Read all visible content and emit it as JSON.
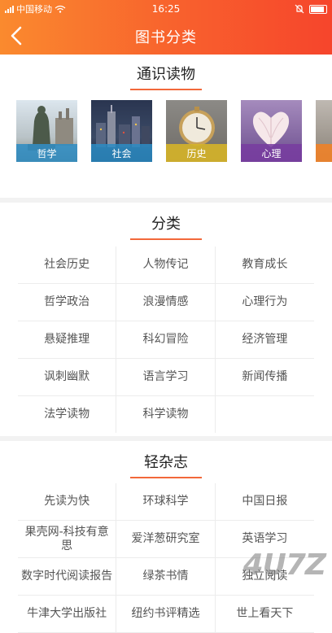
{
  "status_bar": {
    "carrier": "中国移动",
    "time": "16:25"
  },
  "nav": {
    "title": "图书分类"
  },
  "sections": {
    "general": {
      "title": "通识读物",
      "cards": [
        {
          "label": "哲学",
          "color": "#3a8fbf"
        },
        {
          "label": "社会",
          "color": "#3a8fbf"
        },
        {
          "label": "历史",
          "color": "#c9ae2c"
        },
        {
          "label": "心理",
          "color": "#7a3f9b"
        }
      ]
    },
    "category": {
      "title": "分类",
      "items": [
        "社会历史",
        "人物传记",
        "教育成长",
        "哲学政治",
        "浪漫情感",
        "心理行为",
        "悬疑推理",
        "科幻冒险",
        "经济管理",
        "讽刺幽默",
        "语言学习",
        "新闻传播",
        "法学读物",
        "科学读物",
        ""
      ]
    },
    "magazine": {
      "title": "轻杂志",
      "items": [
        "先读为快",
        "环球科学",
        "中国日报",
        "果壳网-科技有意思",
        "爱洋葱研究室",
        "英语学习",
        "数字时代阅读报告",
        "绿茶书情",
        "独立阅读",
        "牛津大学出版社",
        "纽约书评精选",
        "世上看天下"
      ]
    }
  },
  "watermark": "4U7Z"
}
